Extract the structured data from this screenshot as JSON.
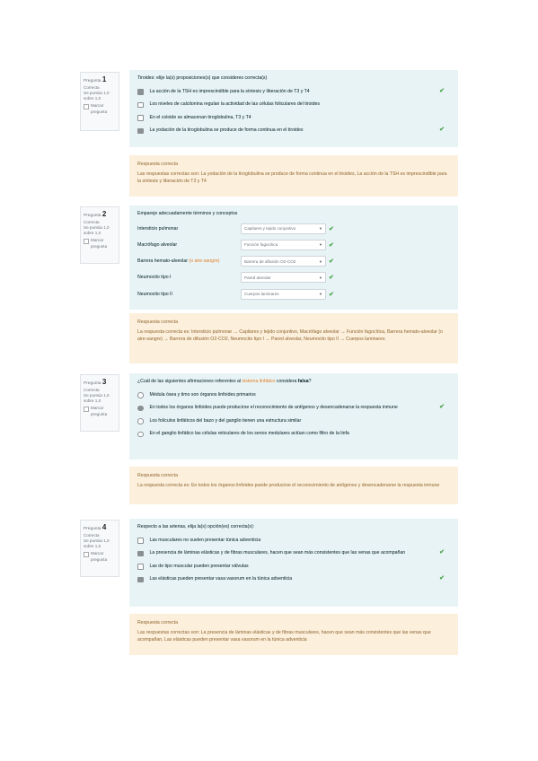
{
  "questions": [
    {
      "number": "1",
      "label": "Pregunta",
      "status": "Correcta",
      "score": "Se puntúa 1,0 sobre 1,0",
      "flag": "Marcar pregunta",
      "text": "Tiroides: elije la(s) proposiciones(s) que consideres correcta(s)",
      "answers": [
        {
          "text": "La acción de la TSH es imprescindible para la síntesis y liberación de T3 y T4",
          "checked": true,
          "correct": true
        },
        {
          "text": "Los niveles de calcitonina regulan la actividad de las células foliculares del tiroides",
          "checked": false,
          "correct": false
        },
        {
          "text": "En el coloide se almacenan tiroglobulina, T3 y T4",
          "checked": false,
          "correct": false
        },
        {
          "text": "La yodación de la tiroglobulina se produce de forma continua en el tiroides",
          "checked": true,
          "correct": true
        }
      ],
      "feedback_title": "Respuesta correcta",
      "feedback_body": "Las respuestas correctas son: La yodación de la tiroglobulina se produce de forma continua en el tiroides, La acción de la TSH es imprescindible para la síntesis y liberación de T3 y T4"
    },
    {
      "number": "2",
      "label": "Pregunta",
      "status": "Correcta",
      "score": "Se puntúa 1,0 sobre 1,0",
      "flag": "Marcar pregunta",
      "text": "Empareje adecuadamente términos y conceptos",
      "rows": [
        {
          "label": "Intersticio pulmonar",
          "value": "Capilares y tejido conjuntivo"
        },
        {
          "label": "Macrófago alveolar",
          "value": "Función fagocítica"
        },
        {
          "label": "Barrera hemato-alveolar (o aire-sangre)",
          "value": "Barrera de difusión O2-CO2"
        },
        {
          "label": "Neumocito tipo I",
          "value": "Pared alveolar"
        },
        {
          "label": "Neumocito tipo II",
          "value": "Cuerpos laminares"
        }
      ],
      "feedback_title": "Respuesta correcta",
      "feedback_body": "La respuesta correcta es: Intersticio pulmonar → Capilares y tejido conjuntivo, Macrófago alveolar → Función fagocítica, Barrera hemato-alveolar (o aire-sangre) → Barrera de difusión O2-CO2, Neumocito tipo I → Pared alveolar, Neumocito tipo II → Cuerpos laminares"
    },
    {
      "number": "3",
      "label": "Pregunta",
      "status": "Correcta",
      "score": "Se puntúa 1,0 sobre 1,0",
      "flag": "Marcar pregunta",
      "text_before": "¿Cuál de las siguientes afirmaciones referentes al ",
      "text_highlight": "sistema linfático",
      "text_middle": " considera ",
      "text_bold": "falsa",
      "text_after": "?",
      "answers": [
        {
          "text": "Médula ósea y timo son órganos linfoides primarios",
          "checked": false,
          "correct": false
        },
        {
          "text": "En todos los órganos linfoides puede producirse el reconocimiento de antígenos y desencadenarse la respuesta inmune",
          "checked": true,
          "correct": true
        },
        {
          "text": "Los folículos linfáticos del bazo y del ganglio tienen una estructura similar",
          "checked": false,
          "correct": false
        },
        {
          "text": "En el ganglio linfático las células reticulares de los senos medulares actúan como filtro de la linfa",
          "checked": false,
          "correct": false
        }
      ],
      "feedback_title": "Respuesta correcta",
      "feedback_body": "La respuesta correcta es: En todos los órganos linfoides puede producirse el reconocimiento de antígenos y desencadenarse la respuesta inmune"
    },
    {
      "number": "4",
      "label": "Pregunta",
      "status": "Correcta",
      "score": "Se puntúa 1,0 sobre 1,0",
      "flag": "Marcar pregunta",
      "text": "Respecto a las arterias, elija la(s) opción(es) correcta(s):",
      "answers": [
        {
          "text": "Las musculares no suelen presentar túnica adventicia",
          "checked": false,
          "correct": false
        },
        {
          "text": "La presencia de láminas elásticas y de fibras musculares, hacen que sean más consistentes que las venas que acompañan",
          "checked": true,
          "correct": true
        },
        {
          "text": "Las de tipo muscular pueden presentar válvulas",
          "checked": false,
          "correct": false
        },
        {
          "text": "Las elásticas pueden presentar vasa vasorum en la túnica adventicia",
          "checked": true,
          "correct": true
        }
      ],
      "feedback_title": "Respuesta correcta",
      "feedback_body": "Las respuestas correctas son: La presencia de láminas elásticas y de fibras musculares, hacen que sean más consistentes que las venas que acompañan, Las elásticas pueden presentar vasa vasorum en la túnica adventicia"
    }
  ],
  "icons": {
    "checkmark": "check-icon",
    "dropdown": "chevron-down-icon"
  },
  "colors": {
    "question_bg": "#e7f3f5",
    "feedback_bg": "#fcefdc",
    "correct": "#4ca64c",
    "feedback_text": "#8e662e"
  }
}
